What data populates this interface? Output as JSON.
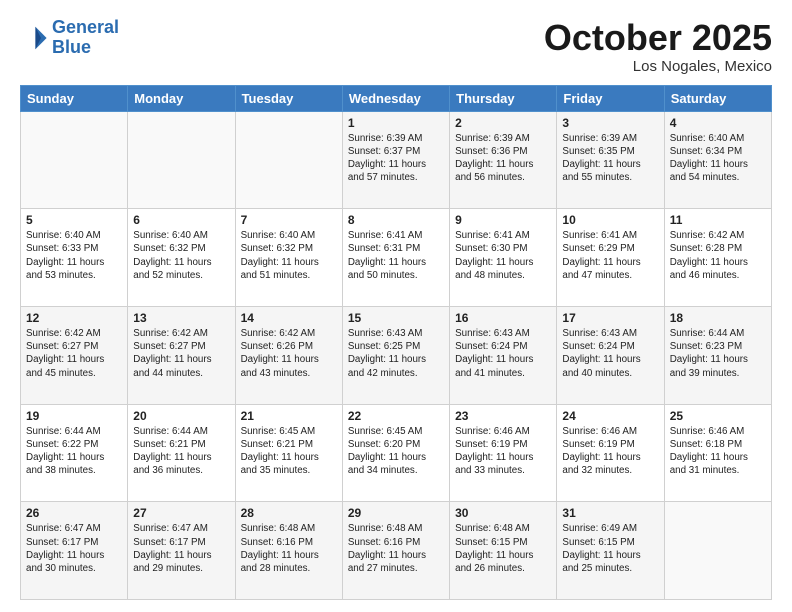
{
  "header": {
    "logo_line1": "General",
    "logo_line2": "Blue",
    "month_title": "October 2025",
    "location": "Los Nogales, Mexico"
  },
  "days_of_week": [
    "Sunday",
    "Monday",
    "Tuesday",
    "Wednesday",
    "Thursday",
    "Friday",
    "Saturday"
  ],
  "weeks": [
    [
      {
        "day": "",
        "info": ""
      },
      {
        "day": "",
        "info": ""
      },
      {
        "day": "",
        "info": ""
      },
      {
        "day": "1",
        "info": "Sunrise: 6:39 AM\nSunset: 6:37 PM\nDaylight: 11 hours\nand 57 minutes."
      },
      {
        "day": "2",
        "info": "Sunrise: 6:39 AM\nSunset: 6:36 PM\nDaylight: 11 hours\nand 56 minutes."
      },
      {
        "day": "3",
        "info": "Sunrise: 6:39 AM\nSunset: 6:35 PM\nDaylight: 11 hours\nand 55 minutes."
      },
      {
        "day": "4",
        "info": "Sunrise: 6:40 AM\nSunset: 6:34 PM\nDaylight: 11 hours\nand 54 minutes."
      }
    ],
    [
      {
        "day": "5",
        "info": "Sunrise: 6:40 AM\nSunset: 6:33 PM\nDaylight: 11 hours\nand 53 minutes."
      },
      {
        "day": "6",
        "info": "Sunrise: 6:40 AM\nSunset: 6:32 PM\nDaylight: 11 hours\nand 52 minutes."
      },
      {
        "day": "7",
        "info": "Sunrise: 6:40 AM\nSunset: 6:32 PM\nDaylight: 11 hours\nand 51 minutes."
      },
      {
        "day": "8",
        "info": "Sunrise: 6:41 AM\nSunset: 6:31 PM\nDaylight: 11 hours\nand 50 minutes."
      },
      {
        "day": "9",
        "info": "Sunrise: 6:41 AM\nSunset: 6:30 PM\nDaylight: 11 hours\nand 48 minutes."
      },
      {
        "day": "10",
        "info": "Sunrise: 6:41 AM\nSunset: 6:29 PM\nDaylight: 11 hours\nand 47 minutes."
      },
      {
        "day": "11",
        "info": "Sunrise: 6:42 AM\nSunset: 6:28 PM\nDaylight: 11 hours\nand 46 minutes."
      }
    ],
    [
      {
        "day": "12",
        "info": "Sunrise: 6:42 AM\nSunset: 6:27 PM\nDaylight: 11 hours\nand 45 minutes."
      },
      {
        "day": "13",
        "info": "Sunrise: 6:42 AM\nSunset: 6:27 PM\nDaylight: 11 hours\nand 44 minutes."
      },
      {
        "day": "14",
        "info": "Sunrise: 6:42 AM\nSunset: 6:26 PM\nDaylight: 11 hours\nand 43 minutes."
      },
      {
        "day": "15",
        "info": "Sunrise: 6:43 AM\nSunset: 6:25 PM\nDaylight: 11 hours\nand 42 minutes."
      },
      {
        "day": "16",
        "info": "Sunrise: 6:43 AM\nSunset: 6:24 PM\nDaylight: 11 hours\nand 41 minutes."
      },
      {
        "day": "17",
        "info": "Sunrise: 6:43 AM\nSunset: 6:24 PM\nDaylight: 11 hours\nand 40 minutes."
      },
      {
        "day": "18",
        "info": "Sunrise: 6:44 AM\nSunset: 6:23 PM\nDaylight: 11 hours\nand 39 minutes."
      }
    ],
    [
      {
        "day": "19",
        "info": "Sunrise: 6:44 AM\nSunset: 6:22 PM\nDaylight: 11 hours\nand 38 minutes."
      },
      {
        "day": "20",
        "info": "Sunrise: 6:44 AM\nSunset: 6:21 PM\nDaylight: 11 hours\nand 36 minutes."
      },
      {
        "day": "21",
        "info": "Sunrise: 6:45 AM\nSunset: 6:21 PM\nDaylight: 11 hours\nand 35 minutes."
      },
      {
        "day": "22",
        "info": "Sunrise: 6:45 AM\nSunset: 6:20 PM\nDaylight: 11 hours\nand 34 minutes."
      },
      {
        "day": "23",
        "info": "Sunrise: 6:46 AM\nSunset: 6:19 PM\nDaylight: 11 hours\nand 33 minutes."
      },
      {
        "day": "24",
        "info": "Sunrise: 6:46 AM\nSunset: 6:19 PM\nDaylight: 11 hours\nand 32 minutes."
      },
      {
        "day": "25",
        "info": "Sunrise: 6:46 AM\nSunset: 6:18 PM\nDaylight: 11 hours\nand 31 minutes."
      }
    ],
    [
      {
        "day": "26",
        "info": "Sunrise: 6:47 AM\nSunset: 6:17 PM\nDaylight: 11 hours\nand 30 minutes."
      },
      {
        "day": "27",
        "info": "Sunrise: 6:47 AM\nSunset: 6:17 PM\nDaylight: 11 hours\nand 29 minutes."
      },
      {
        "day": "28",
        "info": "Sunrise: 6:48 AM\nSunset: 6:16 PM\nDaylight: 11 hours\nand 28 minutes."
      },
      {
        "day": "29",
        "info": "Sunrise: 6:48 AM\nSunset: 6:16 PM\nDaylight: 11 hours\nand 27 minutes."
      },
      {
        "day": "30",
        "info": "Sunrise: 6:48 AM\nSunset: 6:15 PM\nDaylight: 11 hours\nand 26 minutes."
      },
      {
        "day": "31",
        "info": "Sunrise: 6:49 AM\nSunset: 6:15 PM\nDaylight: 11 hours\nand 25 minutes."
      },
      {
        "day": "",
        "info": ""
      }
    ]
  ]
}
